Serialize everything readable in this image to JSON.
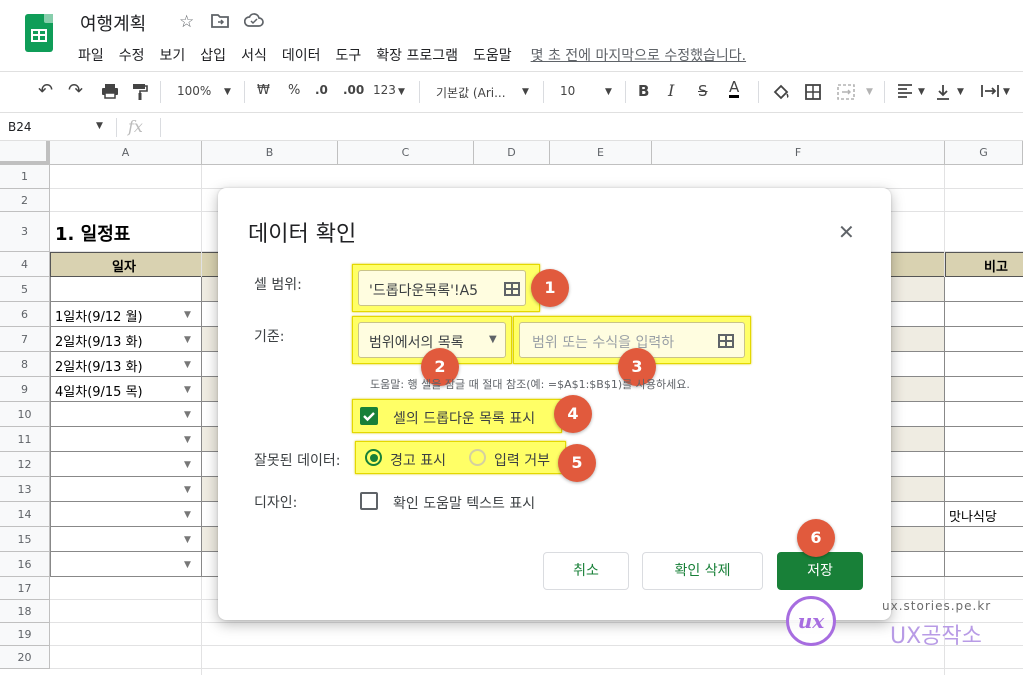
{
  "app": {
    "doc_title": "여행계획",
    "menu": [
      "파일",
      "수정",
      "보기",
      "삽입",
      "서식",
      "데이터",
      "도구",
      "확장 프로그램",
      "도움말"
    ],
    "last_edit": "몇 초 전에 마지막으로 수정했습니다."
  },
  "toolbar": {
    "zoom": "100%",
    "currency": "₩",
    "percent": "%",
    "dec_decrease": ".0",
    "dec_increase": ".00",
    "format_123": "123",
    "font": "기본값 (Ari...",
    "font_size": "10",
    "bold": "B",
    "italic": "I",
    "strike": "S",
    "text_color": "A"
  },
  "formula_bar": {
    "cell_ref": "B24",
    "fx": "fx"
  },
  "sheet": {
    "columns": [
      "A",
      "B",
      "C",
      "D",
      "E",
      "F",
      "G"
    ],
    "rows": [
      "1",
      "2",
      "3",
      "4",
      "5",
      "6",
      "7",
      "8",
      "9",
      "10",
      "11",
      "12",
      "13",
      "14",
      "15",
      "16",
      "17",
      "18",
      "19",
      "20"
    ],
    "section_title": "1. 일정표",
    "header_date": "일자",
    "header_note": "비고",
    "dates": [
      "1일차(9/12 월)",
      "2일차(9/13 화)",
      "2일차(9/13 화)",
      "4일차(9/15 목)"
    ],
    "g14_note": "맛나식당"
  },
  "dialog": {
    "title": "데이터 확인",
    "range_label": "셀 범위:",
    "range_value": "'드롭다운목록'!A5",
    "criteria_label": "기준:",
    "criteria_select": "범위에서의 목록",
    "criteria_placeholder": "범위 또는 수식을 입력하",
    "help_text": "도움말: 행 셀을 잠글 때 절대 참조(예: =$A$1:$B$1)를 사용하세요.",
    "show_dropdown": "셀의 드롭다운 목록 표시",
    "invalid_label": "잘못된 데이터:",
    "warn_option": "경고 표시",
    "reject_option": "입력 거부",
    "design_label": "디자인:",
    "help_checkbox": "확인 도움말 텍스트 표시",
    "cancel": "취소",
    "remove": "확인 삭제",
    "save": "저장",
    "badges": [
      "1",
      "2",
      "3",
      "4",
      "5",
      "6"
    ]
  },
  "watermark": {
    "logo": "ux",
    "url": "ux.stories.pe.kr",
    "name": "UX공작소"
  },
  "colors": {
    "green": "#188038",
    "highlight": "#ffff66",
    "badge": "#e15a3d",
    "header_fill": "#d9d2b1",
    "band_fill": "#efece2"
  }
}
